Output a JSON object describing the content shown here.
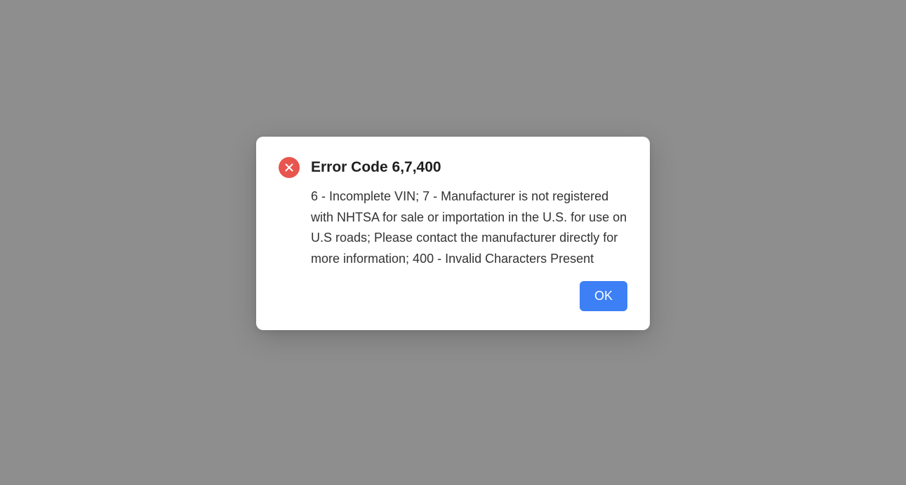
{
  "dialog": {
    "title": "Error Code 6,7,400",
    "message": "6 - Incomplete VIN; 7 - Manufacturer is not registered with NHTSA for sale or importation in the U.S. for use on U.S roads; Please contact the manufacturer directly for more information; 400 - Invalid Characters Present",
    "ok_label": "OK",
    "icon": "error-circle-x-icon"
  },
  "colors": {
    "backdrop": "#8e8e8e",
    "dialog_background": "#ffffff",
    "error_icon": "#e8554e",
    "ok_button": "#3d7ff5",
    "title_text": "#1f1f1f",
    "message_text": "#333333"
  }
}
